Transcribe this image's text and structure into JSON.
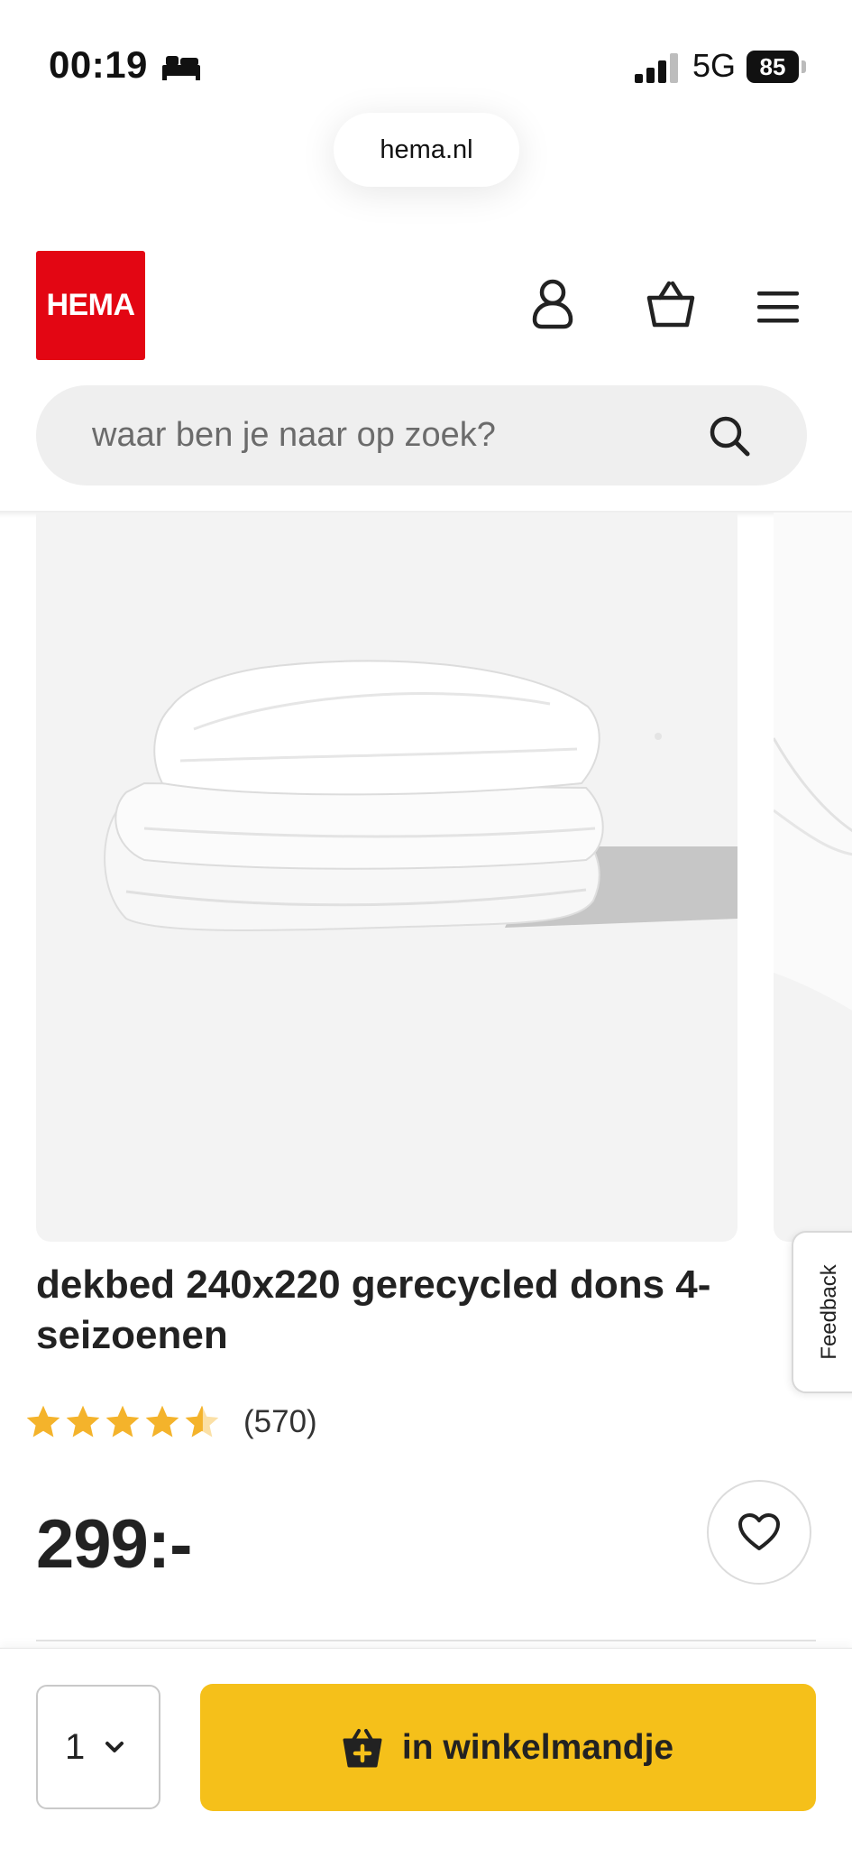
{
  "status_bar": {
    "time": "00:19",
    "network": "5G",
    "battery": "85"
  },
  "browser": {
    "url": "hema.nl"
  },
  "header": {
    "logo_text": "HEMA",
    "brand_color": "#e30613",
    "icons": [
      "person-icon",
      "basket-icon",
      "menu-icon"
    ]
  },
  "search": {
    "placeholder": "waar ben je naar op zoek?"
  },
  "product": {
    "title": "dekbed 240x220 gerecycled dons 4-seizoenen",
    "rating": 4.5,
    "rating_max": 5,
    "review_count": "(570)",
    "price": "299:-"
  },
  "feedback": {
    "label": "Feedback"
  },
  "cart_bar": {
    "quantity": "1",
    "add_label": "in winkelmandje",
    "accent_color": "#f5c01a"
  }
}
